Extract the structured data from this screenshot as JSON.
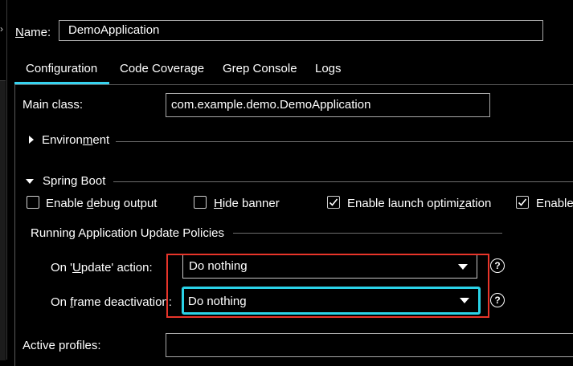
{
  "name": {
    "label_pre": "",
    "label_mnemonic": "N",
    "label_post": "ame:",
    "value": "DemoApplication"
  },
  "tabs": [
    {
      "label": "Configuration",
      "selected": true
    },
    {
      "label": "Code Coverage"
    },
    {
      "label": "Grep Console"
    },
    {
      "label": "Logs"
    }
  ],
  "main_class": {
    "label": "Main class:",
    "value": "com.example.demo.DemoApplication"
  },
  "environment": {
    "label_pre": "Environ",
    "label_mnemonic": "m",
    "label_post": "ent"
  },
  "spring_boot": {
    "label_pre": "Sprin",
    "label_mnemonic": "g",
    "label_post": " Boot",
    "checkboxes": [
      {
        "pre": "Enable ",
        "mnemonic": "d",
        "post": "ebug output",
        "checked": false
      },
      {
        "pre": "",
        "mnemonic": "H",
        "post": "ide banner",
        "checked": false
      },
      {
        "pre": "Enable launch optimi",
        "mnemonic": "z",
        "post": "ation",
        "checked": true
      },
      {
        "pre": "Enable",
        "mnemonic": "",
        "post": "",
        "checked": true
      }
    ]
  },
  "update_policies": {
    "title": "Running Application Update Policies",
    "on_update": {
      "label_pre": "On '",
      "label_mnemonic": "U",
      "label_post": "pdate' action:",
      "value": "Do nothing"
    },
    "on_frame": {
      "label_pre": "On ",
      "label_mnemonic": "f",
      "label_post": "rame deactivation:",
      "value": "Do nothing"
    },
    "help_glyph": "?"
  },
  "active_profiles": {
    "label": "Active profiles:",
    "value": ""
  },
  "colors": {
    "tab_accent": "#36d3f0",
    "focus_border": "#2ad3e8",
    "highlight_red": "#e8352a"
  }
}
